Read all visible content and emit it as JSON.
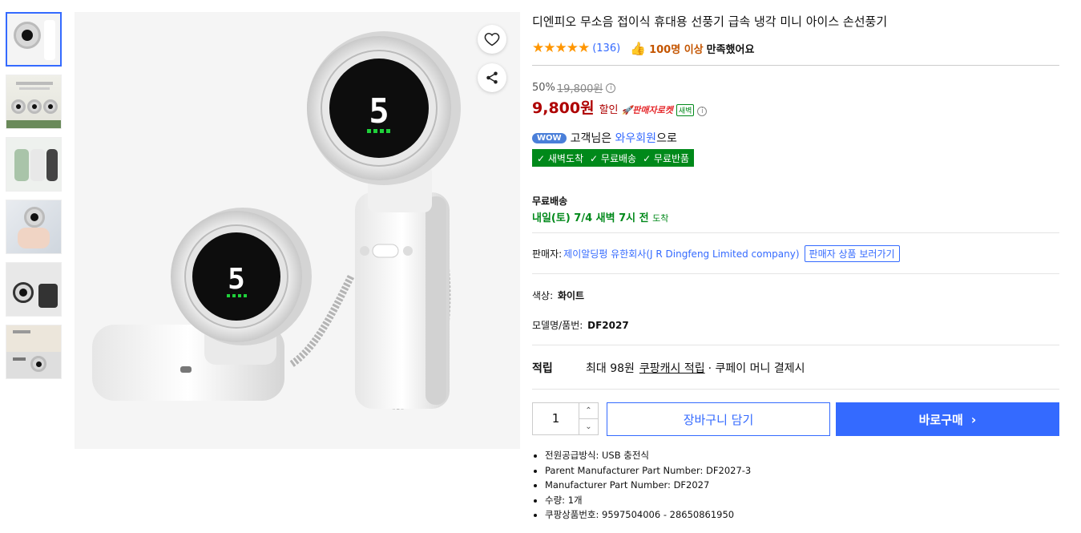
{
  "product": {
    "title": "디엔피오 무소음 접이식 휴대용 선풍기 급속 냉각 미니 아이스 손선풍기",
    "stars": "★★★★★",
    "review_count": "(136)",
    "satisfaction_strong": "100명 이상",
    "satisfaction_rest": "만족했어요",
    "discount_rate": "50%",
    "original_price": "19,800원",
    "price": "9,800원",
    "discount_label": "할인",
    "rocket_label": "🚀판매자로켓",
    "dawn_badge": "새벽",
    "wow_badge": "WOW",
    "wow_text_1": "고객님은",
    "wow_member": "와우회원",
    "wow_text_2": "으로",
    "benefits": [
      "✓ 새벽도착",
      "✓ 무료배송",
      "✓ 무료반품"
    ],
    "shipping_title": "무료배송",
    "shipping_date": "내일(토) 7/4 새벽 7시 전",
    "shipping_suffix": "도착",
    "seller_label": "판매자:",
    "seller_name": "제이알딩펑 유한회사(J R Dingfeng Limited company)",
    "seller_button": "판매자 상품 보러가기",
    "color_label": "색상:",
    "color_value": "화이트",
    "model_label": "모델명/품번:",
    "model_value": "DF2027",
    "points_label": "적립",
    "points_max": "최대 98원",
    "points_link": "쿠팡캐시 적립",
    "points_rest": "· 쿠페이 머니 결제시",
    "quantity": "1",
    "cart_button": "장바구니 담기",
    "buy_button": "바로구매",
    "specs": [
      "전원공급방식: USB 충전식",
      "Parent Manufacturer Part Number: DF2027-3",
      "Manufacturer Part Number: DF2027",
      "수량: 1개",
      "쿠팡상품번호: 9597504006 - 28650861950"
    ]
  },
  "icons": {
    "heart": "heart-icon",
    "share": "share-icon",
    "info": "info-icon",
    "thumbs_up": "thumbs-up-icon",
    "chevron_right": "chevron-right-icon",
    "arrow_up": "arrow-up-icon",
    "arrow_down": "arrow-down-icon"
  },
  "colors": {
    "accent": "#346aff",
    "price_red": "#ae0000",
    "green": "#00891a",
    "star": "#ff9600"
  },
  "image": {
    "fan_display_digit": "5"
  }
}
